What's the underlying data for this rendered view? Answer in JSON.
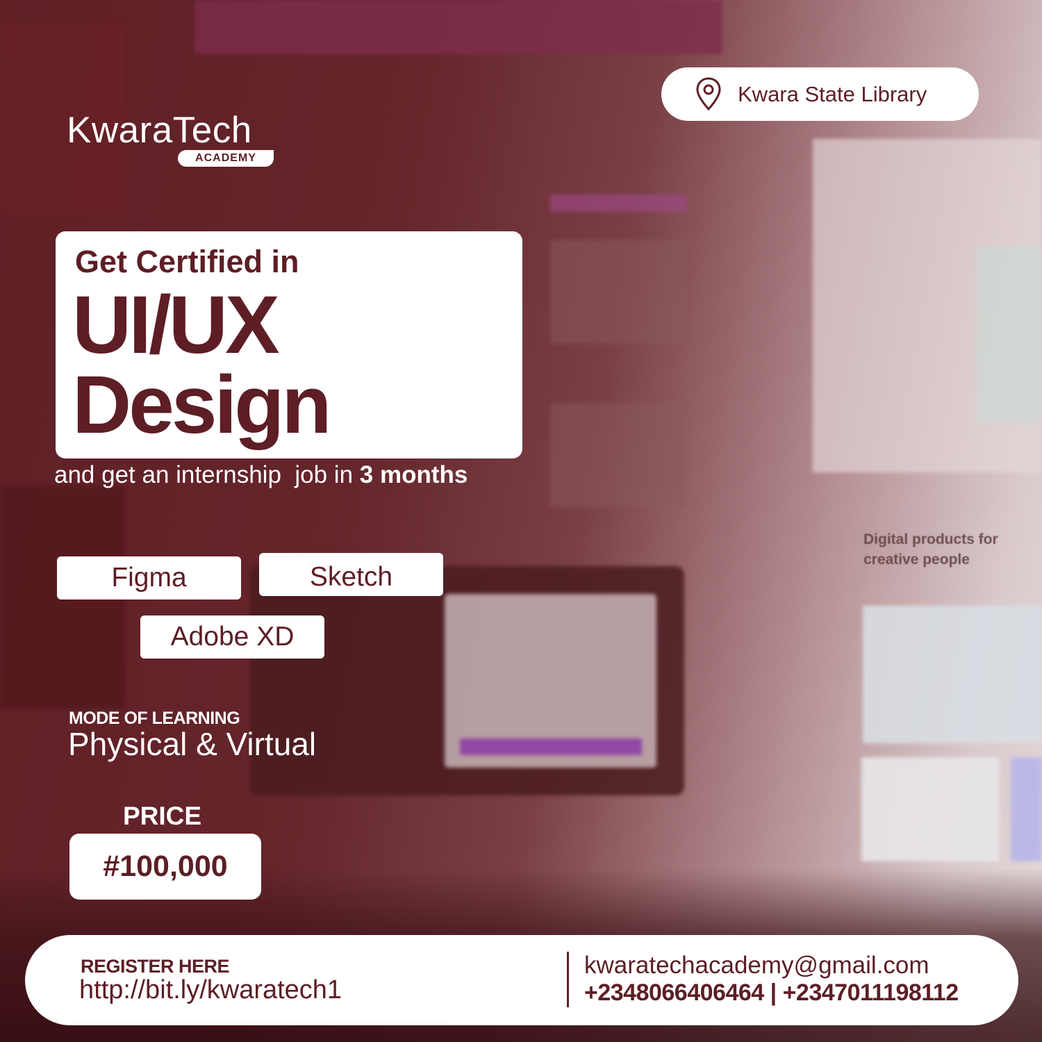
{
  "brand": {
    "name": "KwaraTech",
    "badge": "ACADEMY"
  },
  "location": {
    "icon": "map-pin-icon",
    "text": "Kwara State Library"
  },
  "headline": {
    "kicker": "Get Certified in",
    "line1": "UI/UX",
    "line2": "Design"
  },
  "tagline": {
    "prefix": "and get an internship  job in ",
    "emphasis": "3 months"
  },
  "tools": [
    "Figma",
    "Sketch",
    "Adobe XD"
  ],
  "mode": {
    "label": "MODE OF LEARNING",
    "value": "Physical & Virtual"
  },
  "price": {
    "label": "PRICE",
    "value": "#100,000"
  },
  "register": {
    "label": "REGISTER HERE",
    "link": "http://bit.ly/kwaratech1"
  },
  "contact": {
    "email": "kwaratechacademy@gmail.com",
    "phones": "+2348066406464 | +2347011198112"
  },
  "background_text": {
    "heading": "Digital products for creative people"
  },
  "colors": {
    "brand_maroon": "#5d1e25",
    "white": "#ffffff"
  }
}
